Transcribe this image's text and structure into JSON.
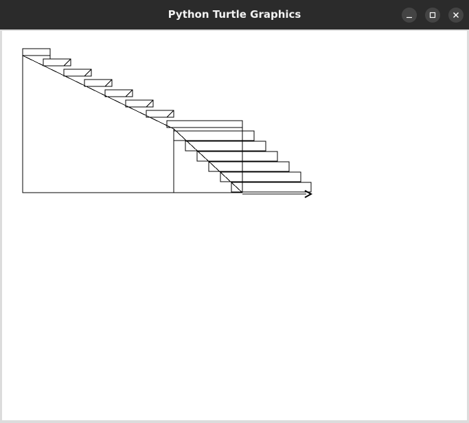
{
  "window": {
    "title": "Python Turtle Graphics",
    "controls": {
      "minimize_icon": "minimize-icon",
      "maximize_icon": "maximize-icon",
      "close_icon": "close-icon"
    }
  },
  "colors": {
    "titlebar": "#2b2b2b",
    "title_text": "#f2f2f2",
    "canvas": "#ffffff",
    "stroke": "#000000"
  },
  "turtle": {
    "icon": "turtle-arrow-icon"
  }
}
